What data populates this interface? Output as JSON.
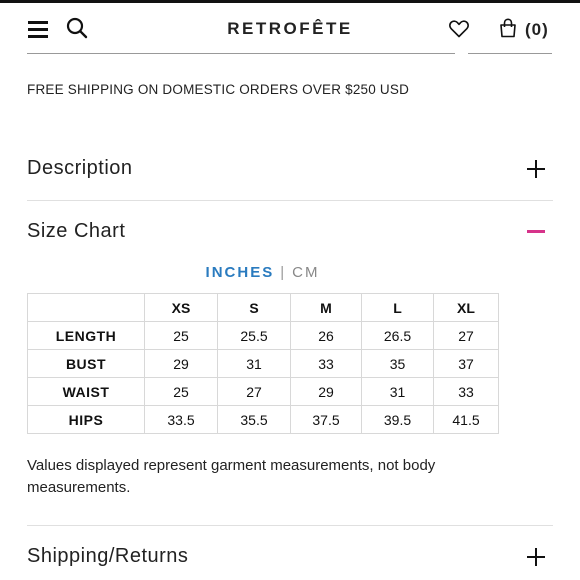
{
  "header": {
    "logo": "RETROFÊTE",
    "cart_count": "(0)"
  },
  "shipping_note": "FREE SHIPPING ON DOMESTIC ORDERS OVER $250 USD",
  "accordions": {
    "description": "Description",
    "size_chart": "Size Chart",
    "shipping": "Shipping/Returns"
  },
  "size_chart": {
    "unit_active": "INCHES",
    "unit_separator": "|",
    "unit_inactive": "CM",
    "columns": [
      "XS",
      "S",
      "M",
      "L",
      "XL"
    ],
    "rows": [
      {
        "label": "LENGTH",
        "values": [
          "25",
          "25.5",
          "26",
          "26.5",
          "27"
        ]
      },
      {
        "label": "BUST",
        "values": [
          "29",
          "31",
          "33",
          "35",
          "37"
        ]
      },
      {
        "label": "WAIST",
        "values": [
          "25",
          "27",
          "29",
          "31",
          "33"
        ]
      },
      {
        "label": "HIPS",
        "values": [
          "33.5",
          "35.5",
          "37.5",
          "39.5",
          "41.5"
        ]
      }
    ],
    "note": "Values displayed represent garment measurements, not body measurements."
  },
  "colors": {
    "accent_blue": "#2a7bbf",
    "minus_pink": "#d6338a"
  },
  "icons": [
    "menu-icon",
    "search-icon",
    "heart-icon",
    "bag-icon",
    "plus-icon",
    "minus-icon"
  ]
}
